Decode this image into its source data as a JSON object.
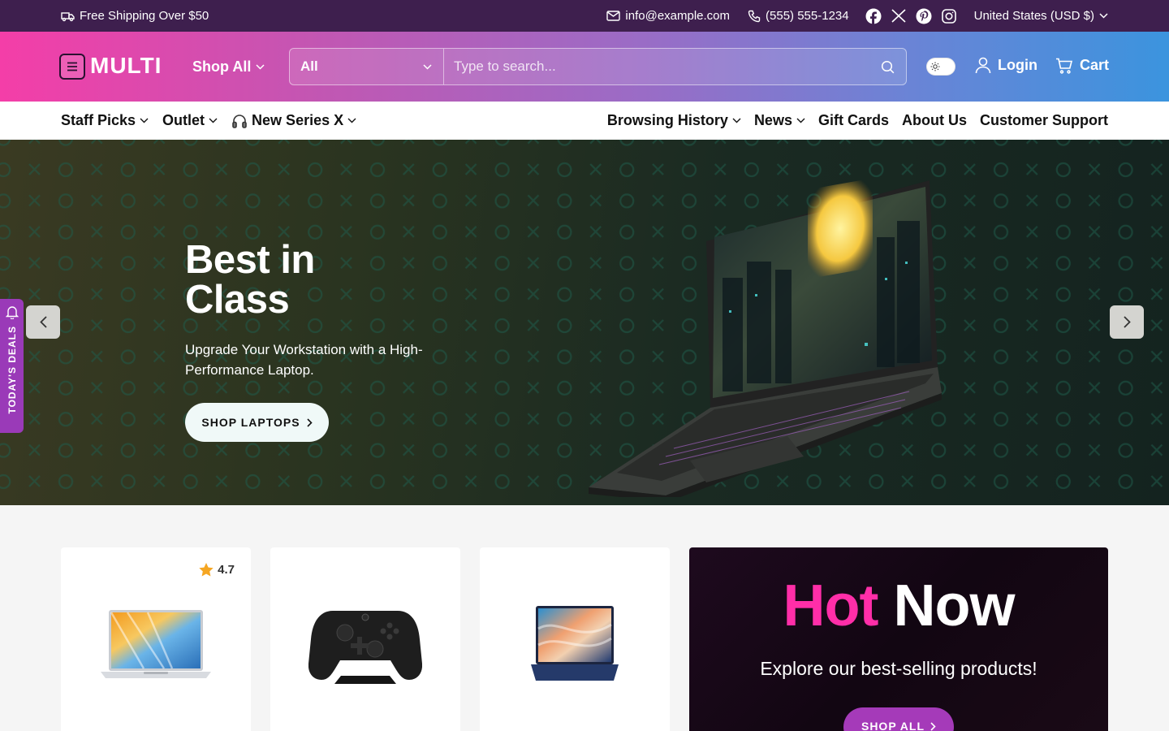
{
  "topbar": {
    "shipping": "Free Shipping Over $50",
    "email": "info@example.com",
    "phone": "(555) 555-1234",
    "social_icons": [
      "facebook-icon",
      "x-icon",
      "pinterest-icon",
      "instagram-icon"
    ],
    "country": "United States (USD $)"
  },
  "header": {
    "logo": "MULTI",
    "shop_all": "Shop All",
    "search_category": "All",
    "search_placeholder": "Type to search...",
    "login": "Login",
    "cart": "Cart"
  },
  "nav": {
    "left": [
      "Staff Picks",
      "Outlet",
      "New Series X"
    ],
    "right": [
      "Browsing History",
      "News",
      "Gift Cards",
      "About Us",
      "Customer Support"
    ]
  },
  "hero": {
    "title": "Best in\nClass",
    "subtitle": "Upgrade Your Workstation with a High-Performance Laptop.",
    "cta": "SHOP LAPTOPS"
  },
  "deals_tab": "TODAY'S DEALS",
  "products": [
    {
      "rating": "4.7",
      "image": "silver-laptop"
    },
    {
      "image": "game-controller"
    },
    {
      "image": "blue-laptop"
    }
  ],
  "promo": {
    "title_pink": "Hot",
    "title_white": "Now",
    "subtitle": "Explore our best-selling products!",
    "cta": "SHOP ALL"
  },
  "colors": {
    "topbar": "#3e1f4e",
    "header_gradient_start": "#f43ea8",
    "header_gradient_end": "#3b94de",
    "accent_pink": "#ff2ea8",
    "button_purple": "#a53ab9"
  }
}
